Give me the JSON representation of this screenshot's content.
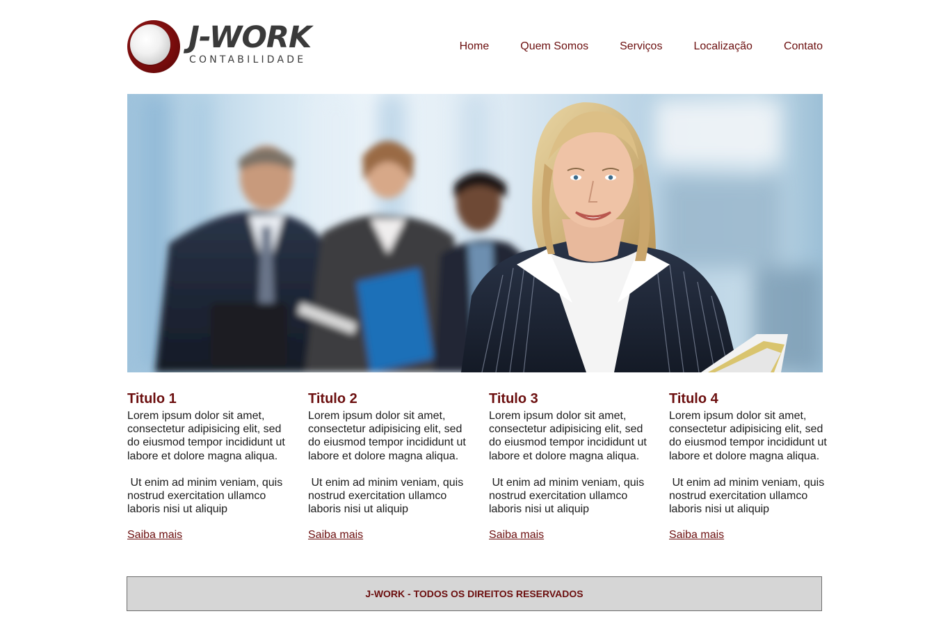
{
  "brand": {
    "name": "J-WORK",
    "tagline": "CONTABILIDADE"
  },
  "nav": {
    "items": [
      "Home",
      "Quem Somos",
      "Serviços",
      "Localização",
      "Contato"
    ]
  },
  "hero": {
    "image": "business-team-photo"
  },
  "columns": [
    {
      "title": "Titulo 1",
      "paragraph1": "Lorem ipsum dolor sit amet, consectetur adipisicing elit, sed do eiusmod tempor incididunt ut labore et dolore magna aliqua.",
      "paragraph2": "Ut enim ad minim veniam, quis nostrud exercitation ullamco laboris nisi ut aliquip",
      "link": "Saiba mais"
    },
    {
      "title": "Titulo 2",
      "paragraph1": "Lorem ipsum dolor sit amet, consectetur adipisicing elit, sed do eiusmod tempor incididunt ut labore et dolore magna aliqua.",
      "paragraph2": "Ut enim ad minim veniam, quis nostrud exercitation ullamco laboris nisi ut aliquip",
      "link": "Saiba mais"
    },
    {
      "title": "Titulo 3",
      "paragraph1": "Lorem ipsum dolor sit amet, consectetur adipisicing elit, sed do eiusmod tempor incididunt ut labore et dolore magna aliqua.",
      "paragraph2": "Ut enim ad minim veniam, quis nostrud exercitation ullamco laboris nisi ut aliquip",
      "link": "Saiba mais"
    },
    {
      "title": "Titulo 4",
      "paragraph1": "Lorem ipsum dolor sit amet, consectetur adipisicing elit, sed do eiusmod tempor incididunt ut labore et dolore magna aliqua.",
      "paragraph2": "Ut enim ad minim veniam, quis nostrud exercitation ullamco laboris nisi ut aliquip",
      "link": "Saiba mais"
    }
  ],
  "footer": {
    "text": "J-WORK - TODOS OS DIREITOS RESERVADOS"
  },
  "colors": {
    "accent": "#6b0e0e",
    "footer_bg": "#d6d6d6"
  }
}
